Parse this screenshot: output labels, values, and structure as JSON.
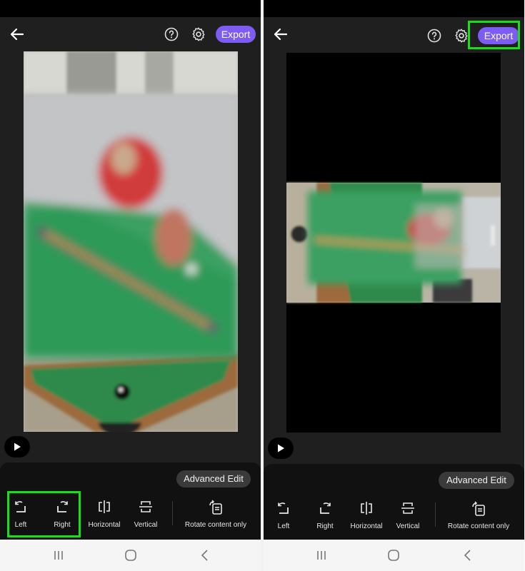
{
  "screens": [
    {
      "topbar": {
        "export_label": "Export"
      },
      "bottom_sheet": {
        "advanced_edit_label": "Advanced Edit",
        "tools": [
          {
            "label": "Left",
            "icon": "rotate-left-icon"
          },
          {
            "label": "Right",
            "icon": "rotate-right-icon"
          },
          {
            "label": "Horizontal",
            "icon": "flip-horizontal-icon"
          },
          {
            "label": "Vertical",
            "icon": "flip-vertical-icon"
          },
          {
            "label": "Rotate content only",
            "icon": "rotate-content-icon"
          }
        ]
      },
      "highlighted": "Left / Right rotate buttons"
    },
    {
      "topbar": {
        "export_label": "Export"
      },
      "bottom_sheet": {
        "advanced_edit_label": "Advanced Edit",
        "tools": [
          {
            "label": "Left",
            "icon": "rotate-left-icon"
          },
          {
            "label": "Right",
            "icon": "rotate-right-icon"
          },
          {
            "label": "Horizontal",
            "icon": "flip-horizontal-icon"
          },
          {
            "label": "Vertical",
            "icon": "flip-vertical-icon"
          },
          {
            "label": "Rotate content only",
            "icon": "rotate-content-icon"
          }
        ]
      },
      "highlighted": "Export button"
    }
  ],
  "colors": {
    "accent": "#7c5cf5",
    "highlight": "#18e018",
    "app_background": "#1f1f1f",
    "sheet_background": "#111111"
  }
}
